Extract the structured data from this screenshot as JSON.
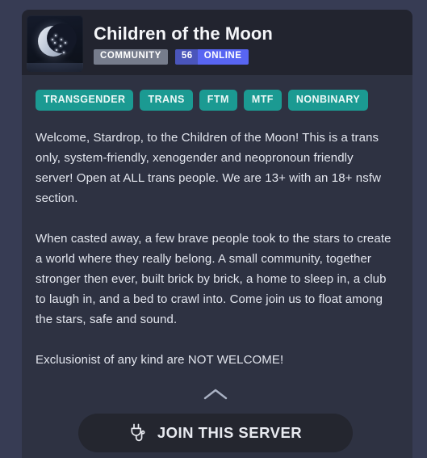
{
  "server": {
    "name": "Children of the Moon",
    "icon_alt": "crescent-moon-icon",
    "badges": {
      "type_label": "COMMUNITY",
      "online_count": "56",
      "online_label": "ONLINE"
    },
    "tags": [
      "TRANSGENDER",
      "TRANS",
      "FTM",
      "MTF",
      "NONBINARY"
    ],
    "description_paragraphs": [
      "Welcome, Stardrop, to the Children of the Moon! This is a trans only, system-friendly, xenogender and neopronoun friendly server! Open at ALL trans people. We are 13+ with an 18+ nsfw section.",
      "When casted away, a few brave people took to the stars to create a world where they really belong. A small community, together stronger then ever, built brick by brick, a home to sleep in, a club to laugh in, and a bed to crawl into. Come join us to float among the stars, safe and sound.",
      "Exclusionist of any kind are NOT WELCOME!"
    ]
  },
  "footer": {
    "collapse_icon": "chevron-up-icon",
    "join_icon": "plug-icon",
    "join_label": "JOIN THIS SERVER"
  },
  "colors": {
    "page_background": "#373c54",
    "card_background": "#2e3242",
    "header_background": "#22242f",
    "tag_teal": "#1b9a92",
    "badge_grey": "#767c8c",
    "badge_blurple": "#5865f2",
    "badge_blurple_dark": "#4a55bb",
    "button_background": "#24262f",
    "text_primary": "#e3e6ee"
  }
}
